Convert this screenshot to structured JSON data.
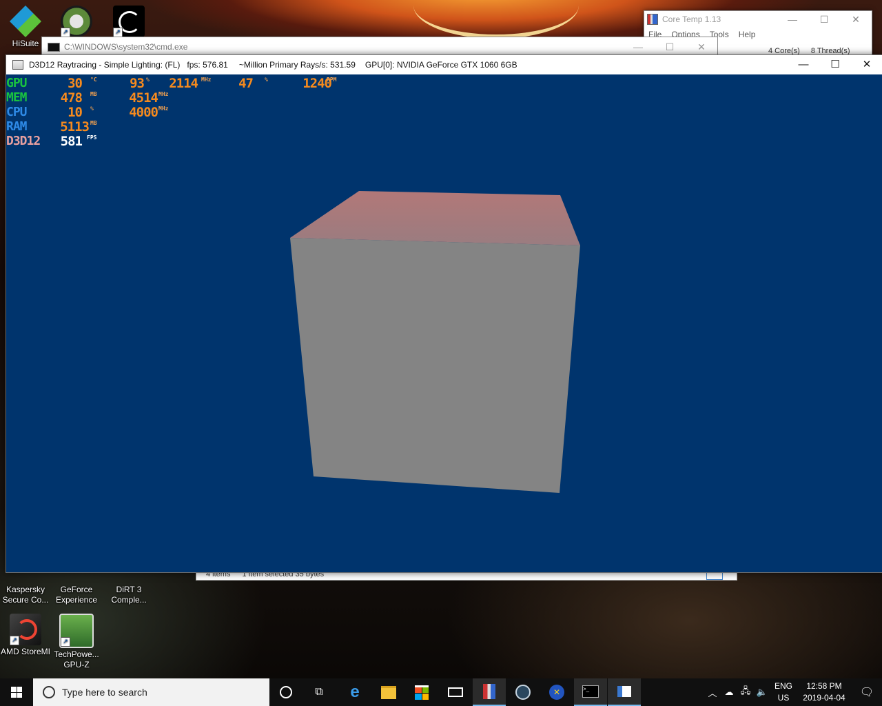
{
  "desktop": {
    "icons_top": [
      {
        "label": "HiSuite",
        "icon": "hisuite-icon",
        "color": "#2aa3d8"
      },
      {
        "label": "",
        "icon": "app-shortcut-icon",
        "color": "#5c8a3a"
      },
      {
        "label": "",
        "icon": "ring-app-icon",
        "color": "#000000"
      }
    ],
    "icons_bottom": [
      {
        "label1": "Kaspersky",
        "label2": "Secure Co...",
        "icon": "kaspersky-icon",
        "color": "#1e8a5a"
      },
      {
        "label1": "GeForce",
        "label2": "Experience",
        "icon": "geforce-icon",
        "color": "#76b900"
      },
      {
        "label1": "DiRT 3",
        "label2": "Comple...",
        "icon": "dirt3-icon",
        "color": "#888888"
      },
      {
        "label1": "AMD StoreMI",
        "label2": "",
        "icon": "amd-storemi-icon",
        "color": "#cc2222"
      },
      {
        "label1": "TechPowe...",
        "label2": "GPU-Z",
        "icon": "gpuz-icon",
        "color": "#3a8a3a"
      }
    ]
  },
  "coretemp": {
    "title": "Core Temp 1.13",
    "menu": [
      "File",
      "Options",
      "Tools",
      "Help"
    ],
    "cores": "4  Core(s)",
    "threads": "8  Thread(s)"
  },
  "cmd": {
    "title": "C:\\WINDOWS\\system32\\cmd.exe"
  },
  "explorer": {
    "status_items": "4 items",
    "status_selected": "1 item selected  35 bytes"
  },
  "d3d": {
    "title": "D3D12 Raytracing - Simple Lighting: (FL)",
    "fps": "fps: 576.81",
    "rays": "~Million Primary Rays/s: 531.59",
    "gpu": "GPU[0]: NVIDIA GeForce GTX 1060 6GB",
    "viewport_color": "#00346d"
  },
  "osd": {
    "rows": [
      {
        "label": "GPU",
        "label_color": "#19c240",
        "cells": [
          {
            "value": "30",
            "unit": "°C"
          },
          {
            "value": "93",
            "unit": "%"
          },
          {
            "value": "2114",
            "unit": "MHz"
          },
          {
            "value": "47",
            "unit": "%"
          },
          {
            "value": "1240",
            "unit": "RPM"
          }
        ]
      },
      {
        "label": "MEM",
        "label_color": "#19c240",
        "cells": [
          {
            "value": "478",
            "unit": "MB"
          },
          {
            "value": "4514",
            "unit": "MHz"
          }
        ]
      },
      {
        "label": "CPU",
        "label_color": "#2e8ae6",
        "cells": [
          {
            "value": "10",
            "unit": "%"
          },
          {
            "value": "4000",
            "unit": "MHz"
          }
        ]
      },
      {
        "label": "RAM",
        "label_color": "#2e8ae6",
        "cells": [
          {
            "value": "5113",
            "unit": "MB"
          }
        ]
      },
      {
        "label": "D3D12",
        "label_color": "#e8a0a0",
        "cells": [
          {
            "value": "581",
            "unit": "FPS"
          }
        ]
      }
    ]
  },
  "taskbar": {
    "search_placeholder": "Type here to search",
    "lang_1": "ENG",
    "lang_2": "US",
    "time": "12:58 PM",
    "date": "2019-04-04"
  }
}
